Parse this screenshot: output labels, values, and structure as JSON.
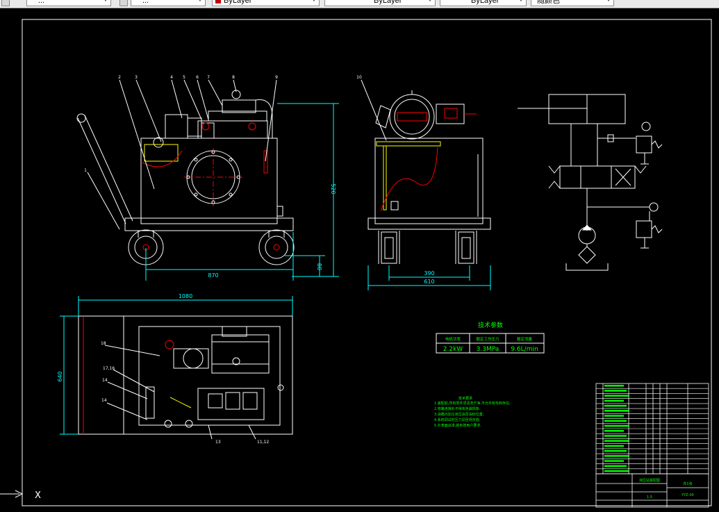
{
  "toolbar": {
    "workspace_value": "...",
    "layer_value": "...",
    "color_value": "ByLayer",
    "linetype_value": "ByLayer",
    "lineweight_value": "ByLayer",
    "plotstyle_value": "随颜色"
  },
  "drawing": {
    "colors": {
      "background": "#000000",
      "outline": "#ffffff",
      "dimension": "#00ffff",
      "leader": "#ffffff",
      "pipe": "#ffff00",
      "section_line": "#ff0000",
      "table_text": "#00ff00",
      "center_line": "#ff0000"
    },
    "front_view": {
      "balloons": [
        "1",
        "2",
        "3",
        "4",
        "5",
        "6",
        "7",
        "8",
        "9"
      ],
      "dim_width": "870",
      "dim_height": "520",
      "dim_base": "80"
    },
    "side_view": {
      "balloons": [
        "10"
      ],
      "dim_inner": "390",
      "dim_outer": "610"
    },
    "top_view": {
      "balloons": [
        "18",
        "17,16",
        "14",
        "14",
        "13",
        "11,12"
      ],
      "dim_length": "1080",
      "dim_width": "640"
    },
    "spec_table": {
      "title": "技术参数",
      "headers": [
        "电机功率",
        "额定工作压力",
        "额定流量"
      ],
      "values": [
        "2.2kW",
        "3.3MPa",
        "9.6L/min"
      ]
    },
    "tech_requirements": {
      "title": "技术要求",
      "lines": [
        "1.装配前,所有零件须清洗干净,不允许有毛刺存在;",
        "2.管路连接处不得有泄漏现象;",
        "3.油箱内加注液压油至油标位置;",
        "4.系统调试时压力调至规定值;",
        "5.外表面涂漆,颜色按用户要求."
      ]
    },
    "title_block": {
      "drawing_name": "液压站装配图",
      "drawing_number": "YYZ-00",
      "scale": "1:5",
      "sheet": "共1张"
    },
    "ucs_label": "X"
  }
}
